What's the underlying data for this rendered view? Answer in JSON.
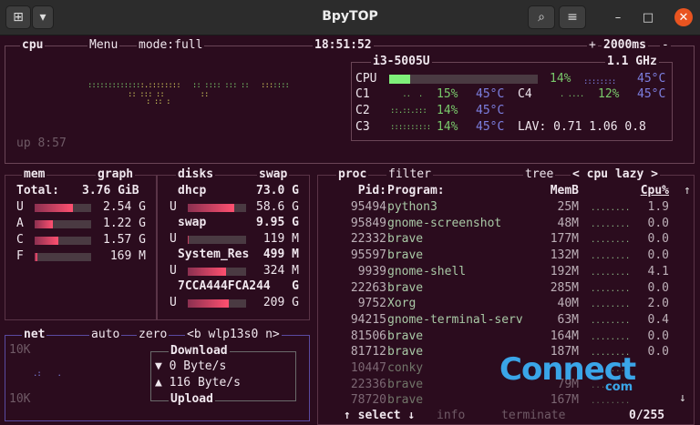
{
  "window": {
    "title": "BpyTOP"
  },
  "cpu": {
    "label": "cpu",
    "menu": "Menu",
    "mode": "mode:full",
    "clock": "18:51:52",
    "plus": "+",
    "interval": "2000ms",
    "minus": "-",
    "model": "i3-5005U",
    "freq": "1.1 GHz",
    "uptime": "up 8:57",
    "total": {
      "name": "CPU",
      "pct": "14%",
      "temp": "45°C",
      "fraction": 0.14
    },
    "cores": [
      {
        "name": "C1",
        "pct": "15%",
        "temp": "45°C"
      },
      {
        "name": "C2",
        "pct": "14%",
        "temp": "45°C"
      },
      {
        "name": "C3",
        "pct": "14%",
        "temp": "45°C"
      },
      {
        "name": "C4",
        "pct": "12%",
        "temp": "45°C"
      }
    ],
    "lav": "LAV: 0.71 1.06 0.8"
  },
  "mem": {
    "label": "mem",
    "graph": "graph",
    "total": "Total:",
    "total_val": "3.76 GiB",
    "rows": [
      {
        "k": "U",
        "v": "2.54 G",
        "f": 0.68
      },
      {
        "k": "A",
        "v": "1.22 G",
        "f": 0.32
      },
      {
        "k": "C",
        "v": "1.57 G",
        "f": 0.42
      },
      {
        "k": "F",
        "v": "169 M",
        "f": 0.05
      }
    ]
  },
  "disks": {
    "label": "disks",
    "swap": "swap",
    "items": [
      {
        "name": "dhcp",
        "size": "73.0 G",
        "u": "U",
        "used": "58.6 G",
        "f": 0.8
      },
      {
        "name": "swap",
        "size": "9.95 G",
        "u": "U",
        "used": "119 M",
        "f": 0.02
      },
      {
        "name": "System_Res",
        "size": "499 M",
        "u": "U",
        "used": "324 M",
        "f": 0.65
      },
      {
        "name": "7CCA444FCA244",
        "size": "G",
        "u": "U",
        "used": "209 G",
        "f": 0.7
      }
    ]
  },
  "net": {
    "label": "net",
    "auto": "auto",
    "zero": "zero",
    "iface": "<b wlp13s0 n>",
    "top": "10K",
    "bottom": "10K",
    "download": "Download",
    "down_val": "▼ 0 Byte/s",
    "up_val": "▲ 116 Byte/s",
    "upload": "Upload"
  },
  "proc": {
    "label": "proc",
    "filter": "filter",
    "tree": "tree",
    "sort": "< cpu lazy >",
    "headers": {
      "pid": "Pid:",
      "program": "Program:",
      "mem": "MemB",
      "cpu": "Cpu%"
    },
    "rows": [
      {
        "pid": "95494",
        "prog": "python3",
        "mem": "25M",
        "cpu": "1.9"
      },
      {
        "pid": "95849",
        "prog": "gnome-screenshot",
        "mem": "48M",
        "cpu": "0.0"
      },
      {
        "pid": "22332",
        "prog": "brave",
        "mem": "177M",
        "cpu": "0.0"
      },
      {
        "pid": "95597",
        "prog": "brave",
        "mem": "132M",
        "cpu": "0.0"
      },
      {
        "pid": "9939",
        "prog": "gnome-shell",
        "mem": "192M",
        "cpu": "4.1"
      },
      {
        "pid": "22263",
        "prog": "brave",
        "mem": "285M",
        "cpu": "0.0"
      },
      {
        "pid": "9752",
        "prog": "Xorg",
        "mem": "40M",
        "cpu": "2.0"
      },
      {
        "pid": "94215",
        "prog": "gnome-terminal-serv",
        "mem": "63M",
        "cpu": "0.4"
      },
      {
        "pid": "81506",
        "prog": "brave",
        "mem": "164M",
        "cpu": "0.0"
      },
      {
        "pid": "81712",
        "prog": "brave",
        "mem": "187M",
        "cpu": "0.0"
      },
      {
        "pid": "10447",
        "prog": "conky",
        "mem": "",
        "cpu": ""
      },
      {
        "pid": "22336",
        "prog": "brave",
        "mem": "79M",
        "cpu": ""
      },
      {
        "pid": "78720",
        "prog": "brave",
        "mem": "167M",
        "cpu": ""
      }
    ],
    "footer_select": "↑ select ↓",
    "footer_info": "info",
    "footer_terminate": "terminate",
    "count": "0/255"
  },
  "watermark": {
    "text": "Connect",
    "sub": "com"
  }
}
